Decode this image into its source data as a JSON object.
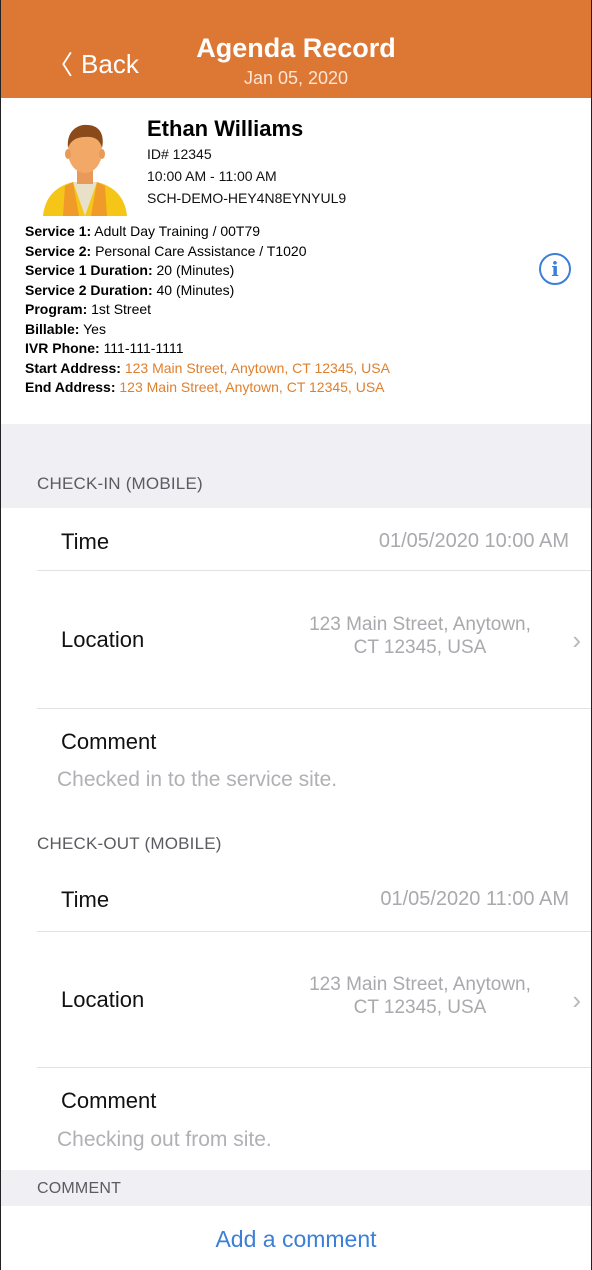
{
  "nav": {
    "back_label": "Back",
    "title": "Agenda Record",
    "date": "Jan 05, 2020",
    "bg_color": "#dd7734"
  },
  "profile": {
    "name": "Ethan Williams",
    "id": "ID# 12345",
    "time_range": "10:00 AM - 11:00 AM",
    "schedule_code": "SCH-DEMO-HEY4N8EYNYUL9",
    "avatar_icon": "person-avatar-icon",
    "details": [
      {
        "label": "Service 1:",
        "value": "Adult Day Training / 00T79"
      },
      {
        "label": "Service 2:",
        "value": "Personal Care Assistance / T1020"
      },
      {
        "label": "Service 1 Duration:",
        "value": "20 (Minutes)"
      },
      {
        "label": "Service 2 Duration:",
        "value": "40 (Minutes)"
      },
      {
        "label": "Program:",
        "value": "1st Street"
      },
      {
        "label": "Billable:",
        "value": "Yes"
      },
      {
        "label": "IVR Phone:",
        "value": "111-111-1111"
      },
      {
        "label": "Start Address:",
        "value": "123 Main Street, Anytown, CT 12345, USA"
      },
      {
        "label": "End Address:",
        "value": "123 Main Street, Anytown, CT 12345, USA"
      }
    ],
    "info_icon": "info-icon"
  },
  "checkin": {
    "header": "CHECK-IN (MOBILE)",
    "time_label": "Time",
    "time_value": "01/05/2020 10:00 AM",
    "location_label": "Location",
    "location_line1": "123 Main Street, Anytown,",
    "location_line2": "CT 12345, USA",
    "comment_label": "Comment",
    "comment_text": "Checked in to the service site."
  },
  "checkout": {
    "header": "CHECK-OUT (MOBILE)",
    "time_label": "Time",
    "time_value": "01/05/2020 11:00 AM",
    "location_label": "Location",
    "location_line1": "123 Main Street, Anytown,",
    "location_line2": "CT 12345, USA",
    "comment_label": "Comment",
    "comment_text": "Checking out from site."
  },
  "comment_section": {
    "header": "COMMENT",
    "add_label": "Add a comment"
  }
}
